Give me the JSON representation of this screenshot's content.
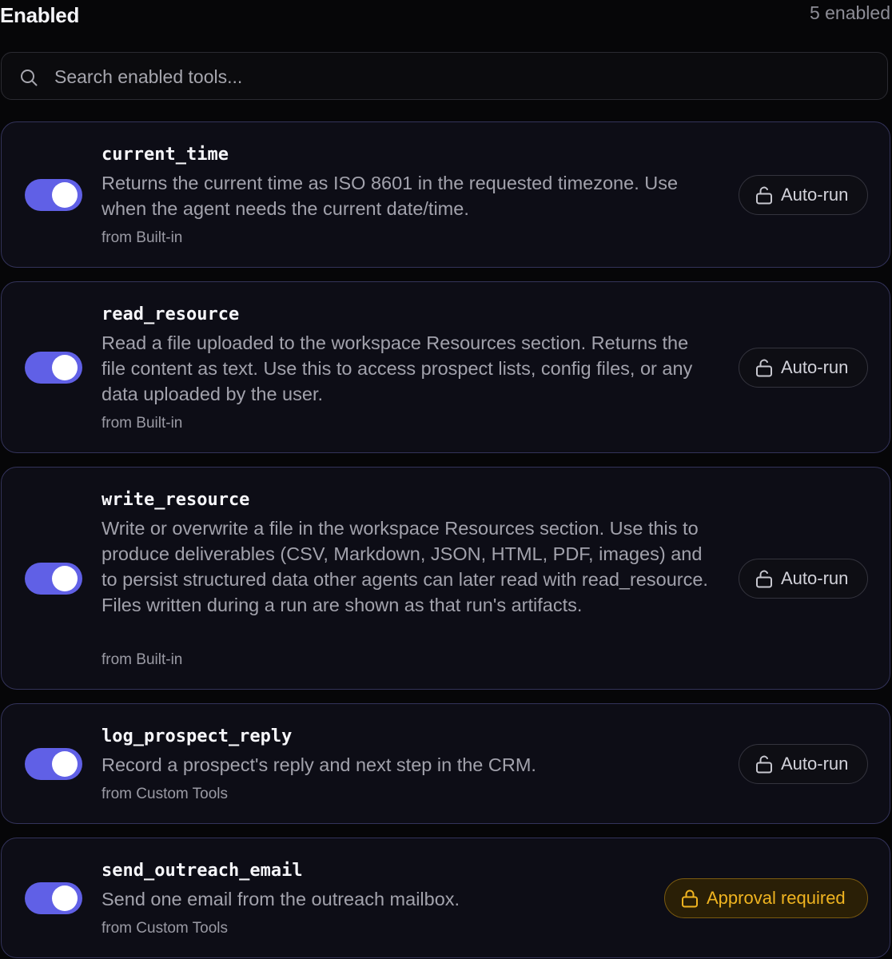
{
  "header": {
    "title": "Enabled",
    "count": "5 enabled"
  },
  "search": {
    "placeholder": "Search enabled tools...",
    "icon": "search-icon"
  },
  "colors": {
    "toggle_on": "#6060e6",
    "card_border": "#33335a",
    "approval_text": "#f0b420",
    "approval_bg": "#2a1f06"
  },
  "tools": [
    {
      "name": "current_time",
      "description": "Returns the current time as ISO 8601 in the requested timezone. Use when the agent needs the current date/time.",
      "source": "from Built-in",
      "enabled": true,
      "policy": "Auto-run",
      "policy_icon": "unlock-icon"
    },
    {
      "name": "read_resource",
      "description": "Read a file uploaded to the workspace Resources section. Returns the file content as text. Use this to access prospect lists, config files, or any data uploaded by the user.",
      "source": "from Built-in",
      "enabled": true,
      "policy": "Auto-run",
      "policy_icon": "unlock-icon"
    },
    {
      "name": "write_resource",
      "description": "Write or overwrite a file in the workspace Resources section. Use this to produce deliverables (CSV, Markdown, JSON, HTML, PDF, images) and to persist structured data other agents can later read with read_resource. Files written during a run are shown as that run's artifacts.",
      "source": "from Built-in",
      "enabled": true,
      "policy": "Auto-run",
      "policy_icon": "unlock-icon"
    },
    {
      "name": "log_prospect_reply",
      "description": "Record a prospect's reply and next step in the CRM.",
      "source": "from Custom Tools",
      "enabled": true,
      "policy": "Auto-run",
      "policy_icon": "unlock-icon"
    },
    {
      "name": "send_outreach_email",
      "description": "Send one email from the outreach mailbox.",
      "source": "from Custom Tools",
      "enabled": true,
      "policy": "Approval required",
      "policy_icon": "lock-icon"
    }
  ]
}
